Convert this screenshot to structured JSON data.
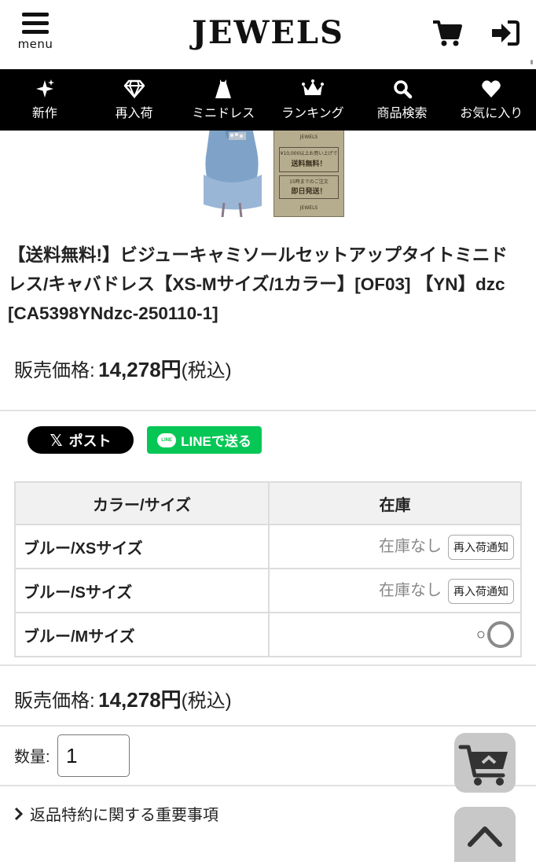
{
  "header": {
    "menu_label": "menu",
    "logo": "JEWELS",
    "cart_icon": "cart-icon",
    "login_icon": "login-icon"
  },
  "nav": [
    {
      "label": "新作",
      "icon": "sparkle-icon"
    },
    {
      "label": "再入荷",
      "icon": "diamond-icon"
    },
    {
      "label": "ミニドレス",
      "icon": "dress-icon"
    },
    {
      "label": "ランキング",
      "icon": "crown-icon"
    },
    {
      "label": "商品検索",
      "icon": "search-icon"
    },
    {
      "label": "お気に入り",
      "icon": "heart-icon"
    }
  ],
  "promo_card": {
    "line1": "¥10,000以上お買い上げで",
    "line2": "送料無料！",
    "line3": "15時までのご注文",
    "line4": "即日発送！",
    "brand": "JEWELS"
  },
  "product": {
    "title": "【送料無料!】ビジューキャミソールセットアップタイトミニドレス/キャバドレス【XS-Mサイズ/1カラー】[OF03] 【YN】dzc [CA5398YNdzc-250110-1]",
    "price_label": "販売価格:",
    "price_value": "14,278円",
    "price_tax": "(税込)"
  },
  "share": {
    "x_label": "ポスト",
    "x_glyph": "𝕏",
    "line_label": "LINEで送る",
    "line_logo_text": "LINE"
  },
  "stock_table": {
    "headers": [
      "カラー/サイズ",
      "在庫"
    ],
    "rows": [
      {
        "variant": "ブルー/XSサイズ",
        "status": "在庫なし",
        "button": "再入荷通知"
      },
      {
        "variant": "ブルー/Sサイズ",
        "status": "在庫なし",
        "button": "再入荷通知"
      },
      {
        "variant": "ブルー/Mサイズ",
        "status": "○"
      }
    ]
  },
  "quantity": {
    "label": "数量:",
    "value": "1"
  },
  "returns_link": "返品特約に関する重要事項"
}
